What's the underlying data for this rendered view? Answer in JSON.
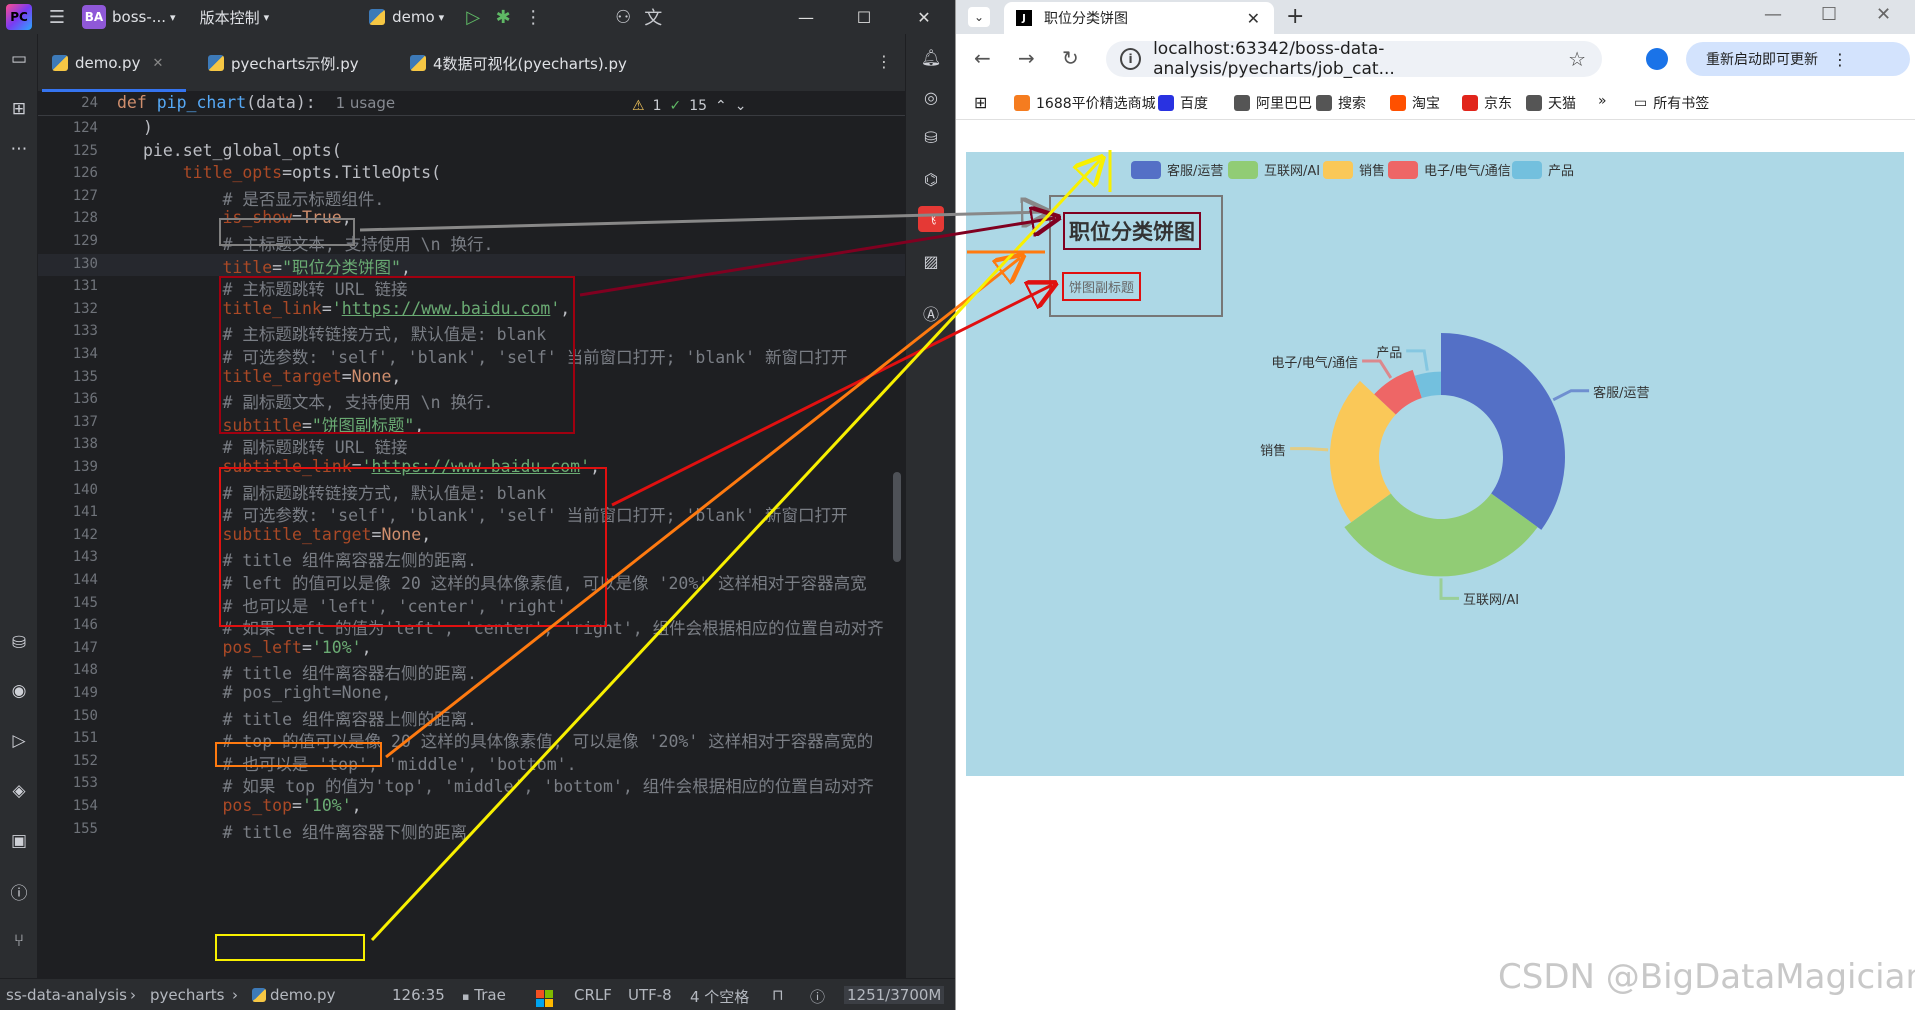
{
  "ide": {
    "project_badge": "BA",
    "project_name": "boss-...",
    "vcs_label": "版本控制",
    "run_config": "demo",
    "tabs": [
      {
        "label": "demo.py",
        "active": true
      },
      {
        "label": "pyecharts示例.py",
        "active": false
      },
      {
        "label": "4数据可视化(pyecharts).py",
        "active": false
      }
    ],
    "inspections": {
      "warnings": "1",
      "ok": "15"
    },
    "sticky_header": {
      "line": "24",
      "code_def": "def ",
      "code_fn": "pip_chart",
      "code_rest": "(data):",
      "usage": "1 usage"
    },
    "lines": [
      {
        "n": "124",
        "segs": [
          {
            "t": ")",
            "c": "plain"
          }
        ]
      },
      {
        "n": "125",
        "segs": [
          {
            "t": "pie.set_global_opts(",
            "c": "plain"
          }
        ]
      },
      {
        "n": "126",
        "segs": [
          {
            "t": "    ",
            "c": "plain"
          },
          {
            "t": "title_opts",
            "c": "param"
          },
          {
            "t": "=opts.TitleOpts(",
            "c": "plain"
          }
        ]
      },
      {
        "n": "127",
        "segs": [
          {
            "t": "        # 是否显示标题组件.",
            "c": "cm"
          }
        ]
      },
      {
        "n": "128",
        "segs": [
          {
            "t": "        ",
            "c": "plain"
          },
          {
            "t": "is_show",
            "c": "param"
          },
          {
            "t": "=",
            "c": "plain"
          },
          {
            "t": "True",
            "c": "kw"
          },
          {
            "t": ",",
            "c": "plain"
          }
        ]
      },
      {
        "n": "129",
        "segs": [
          {
            "t": "        # 主标题文本, 支持使用 \\n 换行.",
            "c": "cm"
          }
        ]
      },
      {
        "n": "130",
        "segs": [
          {
            "t": "        ",
            "c": "plain"
          },
          {
            "t": "title",
            "c": "param"
          },
          {
            "t": "=",
            "c": "plain"
          },
          {
            "t": "\"职位分类饼图\"",
            "c": "str"
          },
          {
            "t": ",",
            "c": "plain"
          }
        ]
      },
      {
        "n": "131",
        "segs": [
          {
            "t": "        # 主标题跳转 URL 链接",
            "c": "cm"
          }
        ]
      },
      {
        "n": "132",
        "segs": [
          {
            "t": "        ",
            "c": "plain"
          },
          {
            "t": "title_link",
            "c": "param"
          },
          {
            "t": "=",
            "c": "plain"
          },
          {
            "t": "'",
            "c": "str"
          },
          {
            "t": "https://www.baidu.com",
            "c": "link"
          },
          {
            "t": "'",
            "c": "str"
          },
          {
            "t": ",",
            "c": "plain"
          }
        ]
      },
      {
        "n": "133",
        "segs": [
          {
            "t": "        # 主标题跳转链接方式, 默认值是: blank",
            "c": "cm"
          }
        ]
      },
      {
        "n": "134",
        "segs": [
          {
            "t": "        # 可选参数: 'self', 'blank', 'self' 当前窗口打开; 'blank' 新窗口打开",
            "c": "cm"
          }
        ]
      },
      {
        "n": "135",
        "segs": [
          {
            "t": "        ",
            "c": "plain"
          },
          {
            "t": "title_target",
            "c": "param"
          },
          {
            "t": "=",
            "c": "plain"
          },
          {
            "t": "None",
            "c": "kw"
          },
          {
            "t": ",",
            "c": "plain"
          }
        ]
      },
      {
        "n": "136",
        "segs": [
          {
            "t": "        # 副标题文本, 支持使用 \\n 换行.",
            "c": "cm"
          }
        ]
      },
      {
        "n": "137",
        "segs": [
          {
            "t": "        ",
            "c": "plain"
          },
          {
            "t": "subtitle",
            "c": "param"
          },
          {
            "t": "=",
            "c": "plain"
          },
          {
            "t": "\"饼图副标题\"",
            "c": "str"
          },
          {
            "t": ",",
            "c": "plain"
          }
        ]
      },
      {
        "n": "138",
        "segs": [
          {
            "t": "        # 副标题跳转 URL 链接",
            "c": "cm"
          }
        ]
      },
      {
        "n": "139",
        "segs": [
          {
            "t": "        ",
            "c": "plain"
          },
          {
            "t": "subtitle_link",
            "c": "param"
          },
          {
            "t": "=",
            "c": "plain"
          },
          {
            "t": "'",
            "c": "str"
          },
          {
            "t": "https://www.baidu.com",
            "c": "link"
          },
          {
            "t": "'",
            "c": "str"
          },
          {
            "t": ",",
            "c": "plain"
          }
        ]
      },
      {
        "n": "140",
        "segs": [
          {
            "t": "        # 副标题跳转链接方式, 默认值是: blank",
            "c": "cm"
          }
        ]
      },
      {
        "n": "141",
        "segs": [
          {
            "t": "        # 可选参数: 'self', 'blank', 'self' 当前窗口打开; 'blank' 新窗口打开",
            "c": "cm"
          }
        ]
      },
      {
        "n": "142",
        "segs": [
          {
            "t": "        ",
            "c": "plain"
          },
          {
            "t": "subtitle_target",
            "c": "param"
          },
          {
            "t": "=",
            "c": "plain"
          },
          {
            "t": "None",
            "c": "kw"
          },
          {
            "t": ",",
            "c": "plain"
          }
        ]
      },
      {
        "n": "143",
        "segs": [
          {
            "t": "        # title 组件离容器左侧的距离.",
            "c": "cm"
          }
        ]
      },
      {
        "n": "144",
        "segs": [
          {
            "t": "        # left 的值可以是像 20 这样的具体像素值, 可以是像 '20%' 这样相对于容器高宽",
            "c": "cm"
          }
        ]
      },
      {
        "n": "145",
        "segs": [
          {
            "t": "        # 也可以是 'left', 'center', 'right'.",
            "c": "cm"
          }
        ]
      },
      {
        "n": "146",
        "segs": [
          {
            "t": "        # 如果 left 的值为'left', 'center', 'right', 组件会根据相应的位置自动对齐",
            "c": "cm"
          }
        ]
      },
      {
        "n": "147",
        "segs": [
          {
            "t": "        ",
            "c": "plain"
          },
          {
            "t": "pos_left",
            "c": "param"
          },
          {
            "t": "=",
            "c": "plain"
          },
          {
            "t": "'10%'",
            "c": "str"
          },
          {
            "t": ",",
            "c": "plain"
          }
        ]
      },
      {
        "n": "148",
        "segs": [
          {
            "t": "        # title 组件离容器右侧的距离.",
            "c": "cm"
          }
        ]
      },
      {
        "n": "149",
        "segs": [
          {
            "t": "        # pos_right=None,",
            "c": "cm"
          }
        ]
      },
      {
        "n": "150",
        "segs": [
          {
            "t": "        # title 组件离容器上侧的距离.",
            "c": "cm"
          }
        ]
      },
      {
        "n": "151",
        "segs": [
          {
            "t": "        # top 的值可以是像 20 这样的具体像素值, 可以是像 '20%' 这样相对于容器高宽的",
            "c": "cm"
          }
        ]
      },
      {
        "n": "152",
        "segs": [
          {
            "t": "        # 也可以是 'top', 'middle', 'bottom'.",
            "c": "cm"
          }
        ]
      },
      {
        "n": "153",
        "segs": [
          {
            "t": "        # 如果 top 的值为'top', 'middle', 'bottom', 组件会根据相应的位置自动对齐",
            "c": "cm"
          }
        ]
      },
      {
        "n": "154",
        "segs": [
          {
            "t": "        ",
            "c": "plain"
          },
          {
            "t": "pos_top",
            "c": "param"
          },
          {
            "t": "=",
            "c": "plain"
          },
          {
            "t": "'10%'",
            "c": "str"
          },
          {
            "t": ",",
            "c": "plain"
          }
        ]
      },
      {
        "n": "155",
        "segs": [
          {
            "t": "        # title 组件离容器下侧的距离",
            "c": "cm"
          }
        ]
      }
    ],
    "status": {
      "breadcrumb": [
        "ss-data-analysis",
        "pyecharts",
        "demo.py"
      ],
      "position": "126:35",
      "tool": "Trae",
      "line_sep": "CRLF",
      "encoding": "UTF-8",
      "indent": "4 个空格",
      "memory": "1251/3700M"
    }
  },
  "browser": {
    "tab_title": "职位分类饼图",
    "url": "localhost:63342/boss-data-analysis/pyecharts/job_cat...",
    "update_button": "重新启动即可更新",
    "bookmarks": [
      "1688平价精选商城",
      "百度",
      "阿里巴巴",
      "搜索",
      "淘宝",
      "京东",
      "天猫"
    ],
    "all_bookmarks": "所有书签",
    "bookmark_colors": [
      "#f57c1f",
      "#2932e1",
      "#555555",
      "#555555",
      "#ff5000",
      "#e1251b",
      "#555555"
    ]
  },
  "chart": {
    "title": "职位分类饼图",
    "subtitle": "饼图副标题"
  },
  "chart_data": {
    "type": "pie",
    "title": "职位分类饼图",
    "subtitle": "饼图副标题",
    "rose_type": "radius",
    "legend_position": "top",
    "categories": [
      "客服/运营",
      "互联网/AI",
      "销售",
      "电子/电气/通信",
      "产品"
    ],
    "colors": [
      "#5470c6",
      "#91cc75",
      "#fac858",
      "#ee6666",
      "#73c0de"
    ],
    "values": [
      35,
      30,
      22,
      8,
      5
    ]
  },
  "watermark": "CSDN @BigDataMagician"
}
